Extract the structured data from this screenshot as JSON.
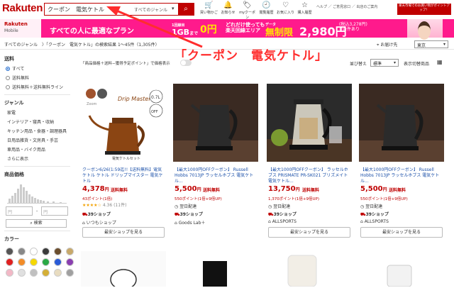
{
  "header": {
    "logo": "Rakuten",
    "search_value": "クーポン　電気ケトル",
    "genre_select": "すべてのジャンル",
    "search_button_icon": "search-icon",
    "icons": [
      {
        "label": "買い物かご",
        "icon": "cart-icon",
        "glyph": "🛒"
      },
      {
        "label": "お知らせ",
        "icon": "bell-icon",
        "glyph": "🔔"
      },
      {
        "label": "myクーポン",
        "icon": "coupon-icon",
        "glyph": "🏷"
      },
      {
        "label": "閲覧履歴",
        "icon": "history-icon",
        "glyph": "🕘"
      },
      {
        "label": "お気に入り",
        "icon": "heart-icon",
        "glyph": "♡"
      },
      {
        "label": "購入履歴",
        "icon": "star-icon",
        "glyph": "☆"
      }
    ],
    "help_links": "ヘルプ ／ ご意見窓口 ／ 出店のご案内",
    "spu_banner": "楽天市場でのお買い物がポイントアップ！"
  },
  "banner": {
    "mobile_logo": "Rakuten",
    "mobile_sub": "Mobile",
    "main_text": "すべての人に最適なプラン",
    "gb_label": "1回線目",
    "gb_text": "1GB",
    "gb_sub": "まで",
    "zero_price": "0円",
    "network_line1": "どれだけ使っても",
    "network_line2": "楽天回線エリア",
    "data_label": "データ",
    "data_text": "無制限",
    "price": "2,980円",
    "price_sub1": "(税込3,278円)",
    "price_sub2": "※条件あり"
  },
  "breadcrumb": {
    "path": "すべてのジャンル　〉「クーポン　電気ケトル」の検索結果 1〜45件（1,305件）",
    "count": "",
    "delivery_label": "お届け先",
    "delivery_value": "東京"
  },
  "annotation": "「クーポン　電気ケトル」",
  "sidebar": {
    "shipping_heading": "送料",
    "shipping_options": [
      {
        "label": "すべて",
        "checked": true
      },
      {
        "label": "送料無料",
        "checked": false
      },
      {
        "label": "送料無料＋送料無料ライン",
        "checked": false
      }
    ],
    "genre_heading": "ジャンル",
    "genres": [
      "家電",
      "インテリア・寝具・収納",
      "キッチン用品・食器・調理器具",
      "日用品雑貨・文房具・手芸",
      "車用品・バイク用品",
      "さらに表示"
    ],
    "price_heading": "商品価格",
    "price_from": "円",
    "price_to": "円",
    "price_sep": "-",
    "search_button": "検索",
    "color_heading": "カラー",
    "colors": [
      "#555555",
      "#888888",
      "#ffffff",
      "#3b3b3b",
      "#6b4e2e",
      "#c8a96a",
      "#e02020",
      "#f28c28",
      "#f5d800",
      "#2aa845",
      "#2a5bd7",
      "#8a3fb0",
      "#f2b8c6",
      "#e0e0e0",
      "#c0c0c0",
      "#d4af37",
      "#e8dcc0",
      "#a0a0a0"
    ]
  },
  "options": {
    "label": "「商品価格＋送料−獲得予定ポイント」で価格表示",
    "sort_label": "並び替え",
    "sort_value": "標準",
    "view_label": "表示切替",
    "view_switch": "商品",
    "view_icon": "grid-icon"
  },
  "products": [
    {
      "title": "クーポン6/26(1:59迄!!【送料無料】電気ケトル ケトル ドリップマイスター 電気ケトル",
      "price": "4,378",
      "yen": "円",
      "shipping": "送料無料",
      "points": "43ポイント(1倍)",
      "rating_stars": "★★★★☆",
      "rating": "4.36 (11件)",
      "delivery": "",
      "shop39": "39ショップ",
      "shop": "いつもショップ",
      "cheapest": "最安ショップを見る",
      "image_caption": "電気ケトルセット"
    },
    {
      "title": "【最大1000円OFFクーポン】 Russell Hobbs 7013JP ラッセルホブス 電気ケトル...",
      "price": "5,500",
      "yen": "円",
      "shipping": "送料無料",
      "points": "550ポイント(1倍+9倍UP)",
      "rating_stars": "",
      "rating": "",
      "delivery": "翌日配達",
      "shop39": "39ショップ",
      "shop": "Goods Lab＋",
      "cheapest": "",
      "image_caption": ""
    },
    {
      "title": "【最大1000円OFFクーポン】 ラッセルホブス PRISMATE PR-SK021 ブリズメイト 電気ケトル...",
      "price": "13,750",
      "yen": "円",
      "shipping": "送料無料",
      "points": "1,370ポイント(1倍+9倍UP)",
      "rating_stars": "",
      "rating": "",
      "delivery": "翌日配達",
      "shop39": "39ショップ",
      "shop": "ALLSPORTS",
      "cheapest": "最安ショップを見る",
      "image_caption": ""
    },
    {
      "title": "【最大1000円OFFクーポン】 Russell Hobbs 7013JP ラッセルホブス 電気ケトル...",
      "price": "5,500",
      "yen": "円",
      "shipping": "送料無料",
      "points": "550ポイント(1倍+9倍UP)",
      "rating_stars": "",
      "rating": "",
      "delivery": "翌日配達",
      "shop39": "39ショップ",
      "shop": "ALLSPORTS",
      "cheapest": "最安ショップを見る",
      "image_caption": ""
    }
  ]
}
